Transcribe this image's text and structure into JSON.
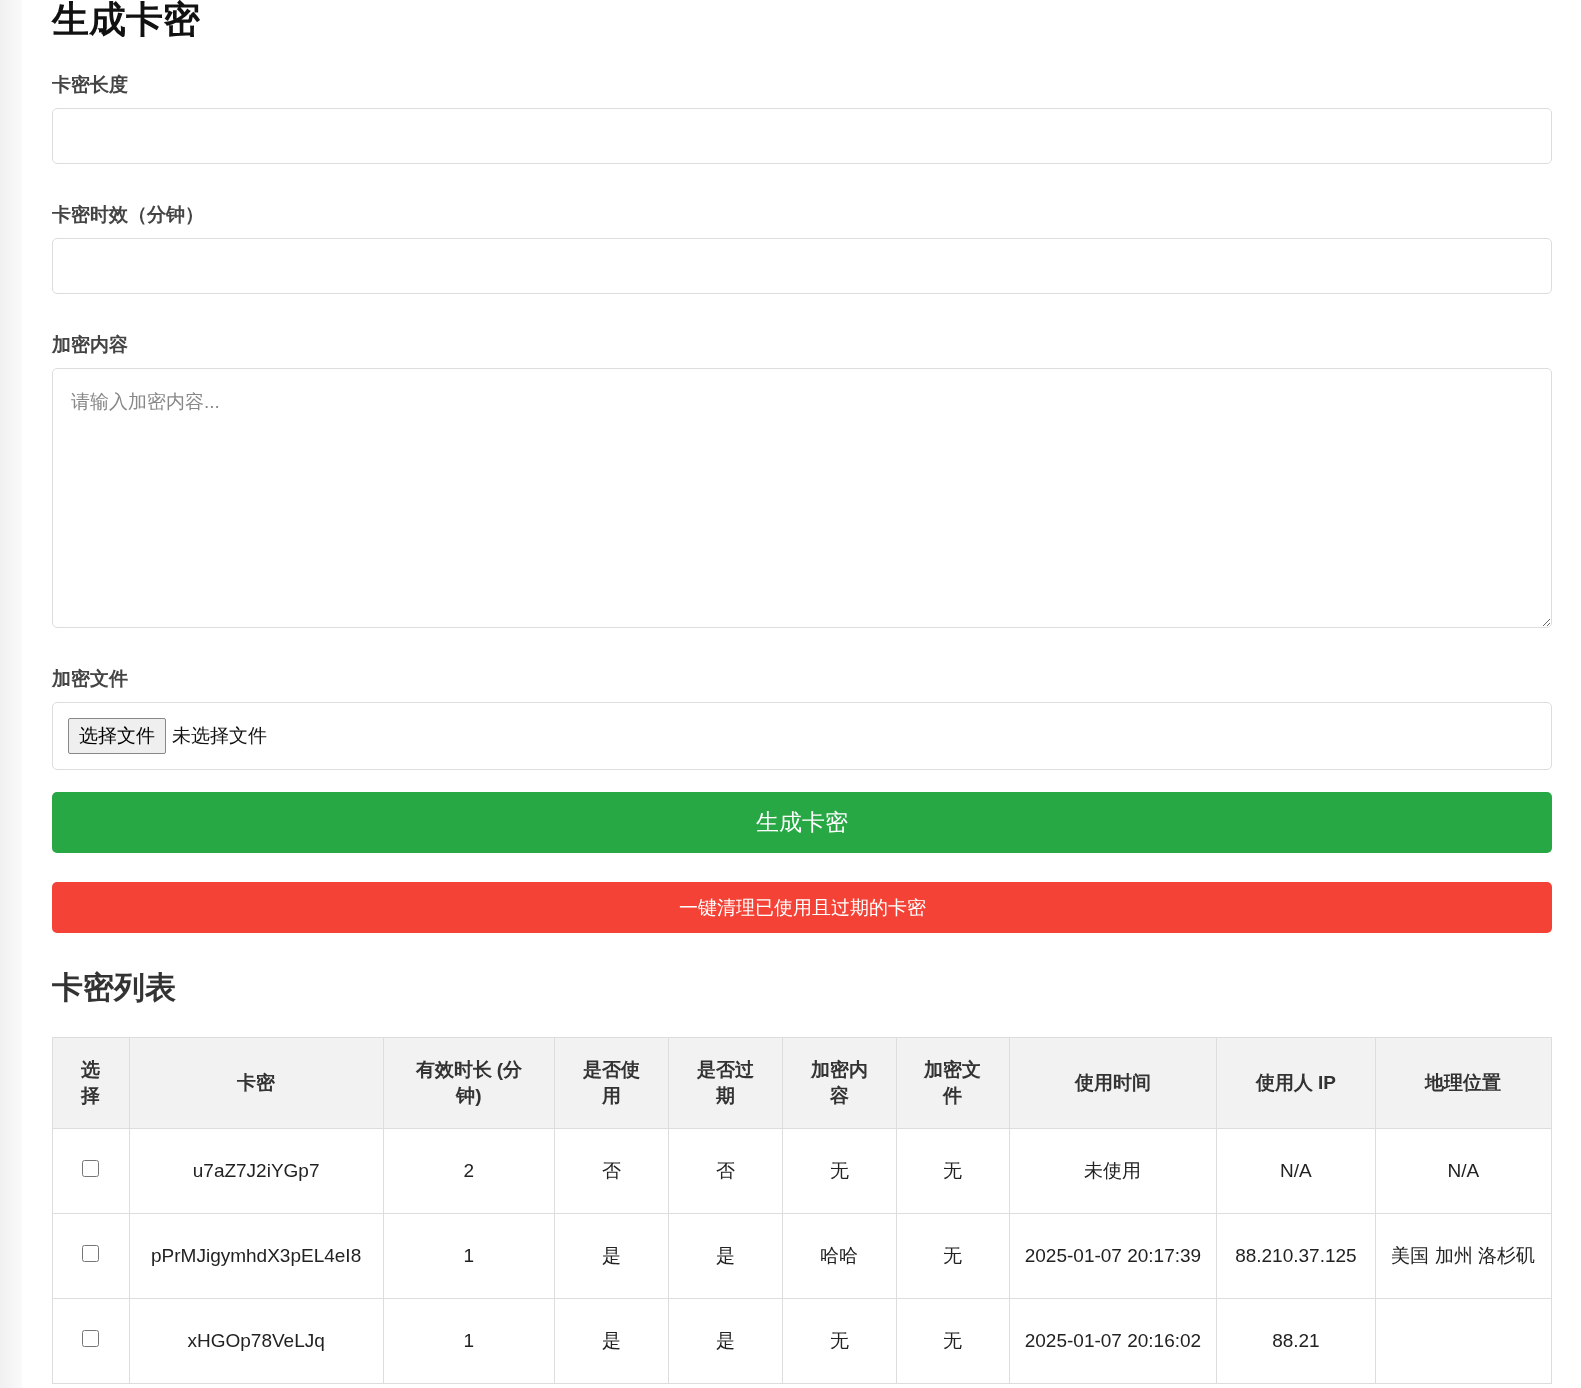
{
  "title": "生成卡密",
  "fields": [
    {
      "kind": "input",
      "label": "卡密长度"
    },
    {
      "kind": "input",
      "label": "卡密时效（分钟）"
    },
    {
      "kind": "textarea",
      "label": "加密内容",
      "placeholder": "请输入加密内容..."
    },
    {
      "kind": "file",
      "label": "加密文件",
      "button": "选择文件",
      "status": "未选择文件"
    }
  ],
  "generate_button": "生成卡密",
  "clean_button": "一键清理已使用且过期的卡密",
  "list_title": "卡密列表",
  "table": {
    "columns": [
      "选择",
      "卡密",
      "有效时长 (分钟)",
      "是否使用",
      "是否过期",
      "加密内容",
      "加密文件",
      "使用时间",
      "使用人 IP",
      "地理位置"
    ],
    "rows": [
      {
        "cells": [
          {
            "kind": "checkbox",
            "checked": false
          },
          "u7aZ7J2iYGp7",
          "2",
          "否",
          "否",
          "无",
          "无",
          "未使用",
          "N/A",
          "N/A"
        ]
      },
      {
        "cells": [
          {
            "kind": "checkbox",
            "checked": false
          },
          "pPrMJigymhdX3pEL4eI8",
          "1",
          "是",
          "是",
          "哈哈",
          "无",
          "2025-01-07 20:17:39",
          "88.210.37.125",
          "美国 加州 洛杉矶"
        ]
      },
      {
        "cells": [
          {
            "kind": "checkbox",
            "checked": false
          },
          "xHGOp78VeLJq",
          "1",
          "是",
          "是",
          "无",
          "无",
          "2025-01-07 20:16:02",
          "88.21"
        ]
      }
    ]
  }
}
